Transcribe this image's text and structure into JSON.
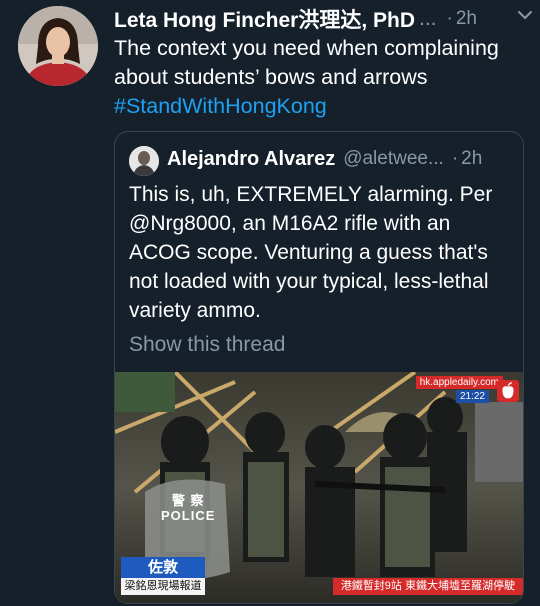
{
  "tweet": {
    "author_name": "Leta Hong Fincher洪理达, PhD",
    "name_ellipsis": "...",
    "separator": "·",
    "time": "2h",
    "text": "The context you need when complaining about students’ bows and arrows",
    "hashtag": "#StandWithHongKong"
  },
  "quoted": {
    "author_name": "Alejandro Alvarez",
    "handle": "@aletwee...",
    "separator": "·",
    "time": "2h",
    "text": "This is, uh, EXTREMELY alarming. Per @Nrg8000, an M16A2 rifle with an ACOG scope. Venturing a guess that's not loaded with your typical, less-lethal variety ammo.",
    "show_thread": "Show this thread"
  },
  "media": {
    "watermark": "hk.appledaily.com",
    "clock": "21:22",
    "shield_text_top": "警 察",
    "shield_text_bottom": "POLICE",
    "reporter_name": "佐敦",
    "reporter_subtitle": "梁銘恩現場報道",
    "ticker": "港鐵暫封9站 東鐵大埔墟至羅湖停駛"
  },
  "colors": {
    "background": "#15202b",
    "secondary_text": "#8899a6",
    "link": "#1da1f2",
    "border": "#38444d"
  },
  "icons": [
    "avatar",
    "chevron-down-icon",
    "quoted-avatar",
    "apple-daily-logo-icon"
  ]
}
